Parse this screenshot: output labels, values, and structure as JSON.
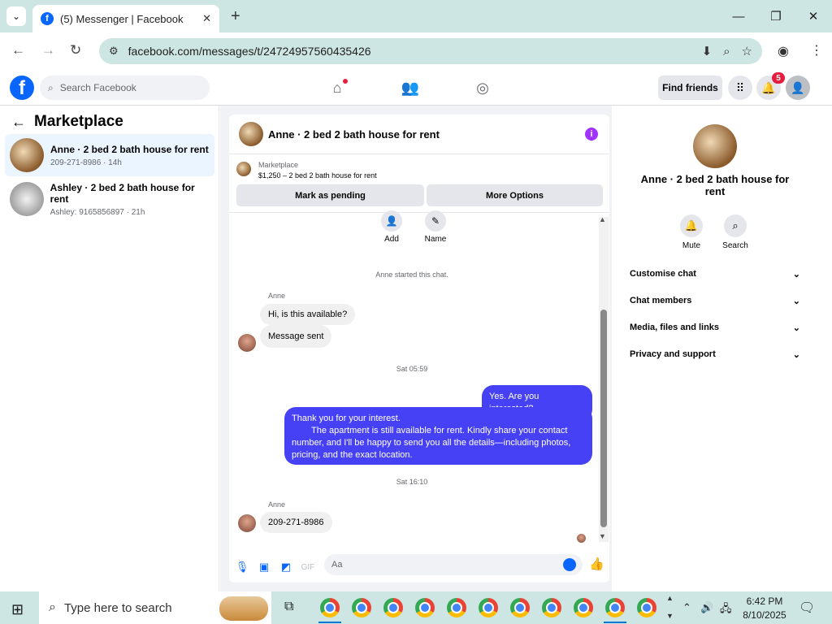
{
  "browser": {
    "tab_title": "(5) Messenger | Facebook",
    "url": "facebook.com/messages/t/24724957560435426",
    "new_tab": "+",
    "icons": [
      "tab-search-icon",
      "close-tab-icon",
      "back-icon",
      "forward-icon",
      "reload-icon",
      "site-info-icon",
      "install-app-icon",
      "zoom-icon",
      "bookmark-star-icon",
      "profile-icon",
      "menu-icon",
      "minimize-icon",
      "maximize-icon",
      "close-window-icon"
    ]
  },
  "fb_header": {
    "logo": "f",
    "search_placeholder": "Search Facebook",
    "find_friends": "Find friends",
    "notification_count": "5",
    "brand_color": "#0866ff"
  },
  "left": {
    "title": "Marketplace",
    "conversations": [
      {
        "title": "Anne · 2 bed 2 bath house for rent",
        "subtitle": "209-271-8986 · 14h",
        "selected": true
      },
      {
        "title": "Ashley · 2 bed 2 bath house for rent",
        "subtitle": "Ashley: 9165856897 · 21h",
        "selected": false
      }
    ]
  },
  "chat": {
    "header_title": "Anne · 2 bed 2 bath house for rent",
    "marketplace_label": "Marketplace",
    "listing": "$1,250 – 2 bed 2 bath house for rent",
    "mark_pending": "Mark as pending",
    "more_options": "More Options",
    "actions": [
      {
        "label": "Add",
        "icon": "add-person-icon"
      },
      {
        "label": "Name",
        "icon": "pencil-icon"
      }
    ],
    "started": "Anne started this chat.",
    "sender1": "Anne",
    "msg1": "Hi, is this available?",
    "msg2": "Message sent",
    "time1": "Sat 05:59",
    "out1": "Yes. Are you interested?",
    "out2_line1": "Thank you for your interest.",
    "out2_body": "The apartment is still available for rent. Kindly share your contact number, and I'll be happy to send you all the details—including photos, pricing, and the exact location.",
    "time2": "Sat 16:10",
    "sender2": "Anne",
    "msg3": "209-271-8986",
    "composer_placeholder": "Aa",
    "outgoing_color": "#4741f5"
  },
  "right": {
    "name": "Anne · 2 bed 2 bath house for rent",
    "actions": [
      {
        "label": "Mute",
        "icon": "bell-icon"
      },
      {
        "label": "Search",
        "icon": "search-icon"
      }
    ],
    "sections": [
      "Customise chat",
      "Chat members",
      "Media, files and links",
      "Privacy and support"
    ]
  },
  "taskbar": {
    "search_placeholder": "Type here to search",
    "time": "6:42 PM",
    "date": "8/10/2025"
  }
}
